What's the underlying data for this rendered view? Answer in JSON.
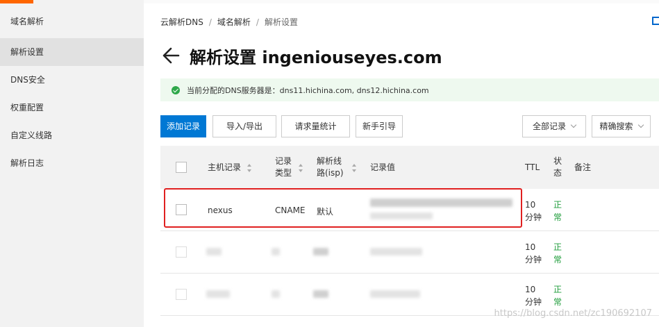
{
  "sidebar": {
    "items": [
      {
        "label": "域名解析"
      },
      {
        "label": "解析设置"
      },
      {
        "label": "DNS安全"
      },
      {
        "label": "权重配置"
      },
      {
        "label": "自定义线路"
      },
      {
        "label": "解析日志"
      }
    ]
  },
  "breadcrumb": {
    "items": [
      "云解析DNS",
      "域名解析",
      "解析设置"
    ],
    "separator": "/"
  },
  "header": {
    "title": "解析设置 ingeniouseyes.com"
  },
  "info_bar": {
    "text": "当前分配的DNS服务器是：dns11.hichina.com, dns12.hichina.com",
    "status_color": "#2ea84a"
  },
  "toolbar": {
    "add_label": "添加记录",
    "import_export_label": "导入/导出",
    "request_stats_label": "请求量统计",
    "guide_label": "新手引导",
    "filter_label": "全部记录",
    "search_label": "精确搜索"
  },
  "table": {
    "headers": {
      "host": "主机记录",
      "type_line1": "记录",
      "type_line2": "类型",
      "line_line1": "解析线",
      "line_line2": "路(isp)",
      "value": "记录值",
      "ttl": "TTL",
      "status_line1": "状",
      "status_line2": "态",
      "remark": "备注"
    },
    "rows": [
      {
        "host": "nexus",
        "type": "CNAME",
        "line": "默认",
        "ttl_line1": "10",
        "ttl_line2": "分钟",
        "status_line1": "正",
        "status_line2": "常"
      },
      {
        "ttl_line1": "10",
        "ttl_line2": "分钟",
        "status_line1": "正",
        "status_line2": "常"
      },
      {
        "ttl_line1": "10",
        "ttl_line2": "分钟",
        "status_line1": "正",
        "status_line2": "常"
      }
    ]
  },
  "colors": {
    "primary": "#0078d4",
    "brand_accent": "#ff6600",
    "status_ok": "#1e9c3a",
    "highlight_border": "#e02020"
  },
  "watermark": "https://blog.csdn.net/zc190692107"
}
